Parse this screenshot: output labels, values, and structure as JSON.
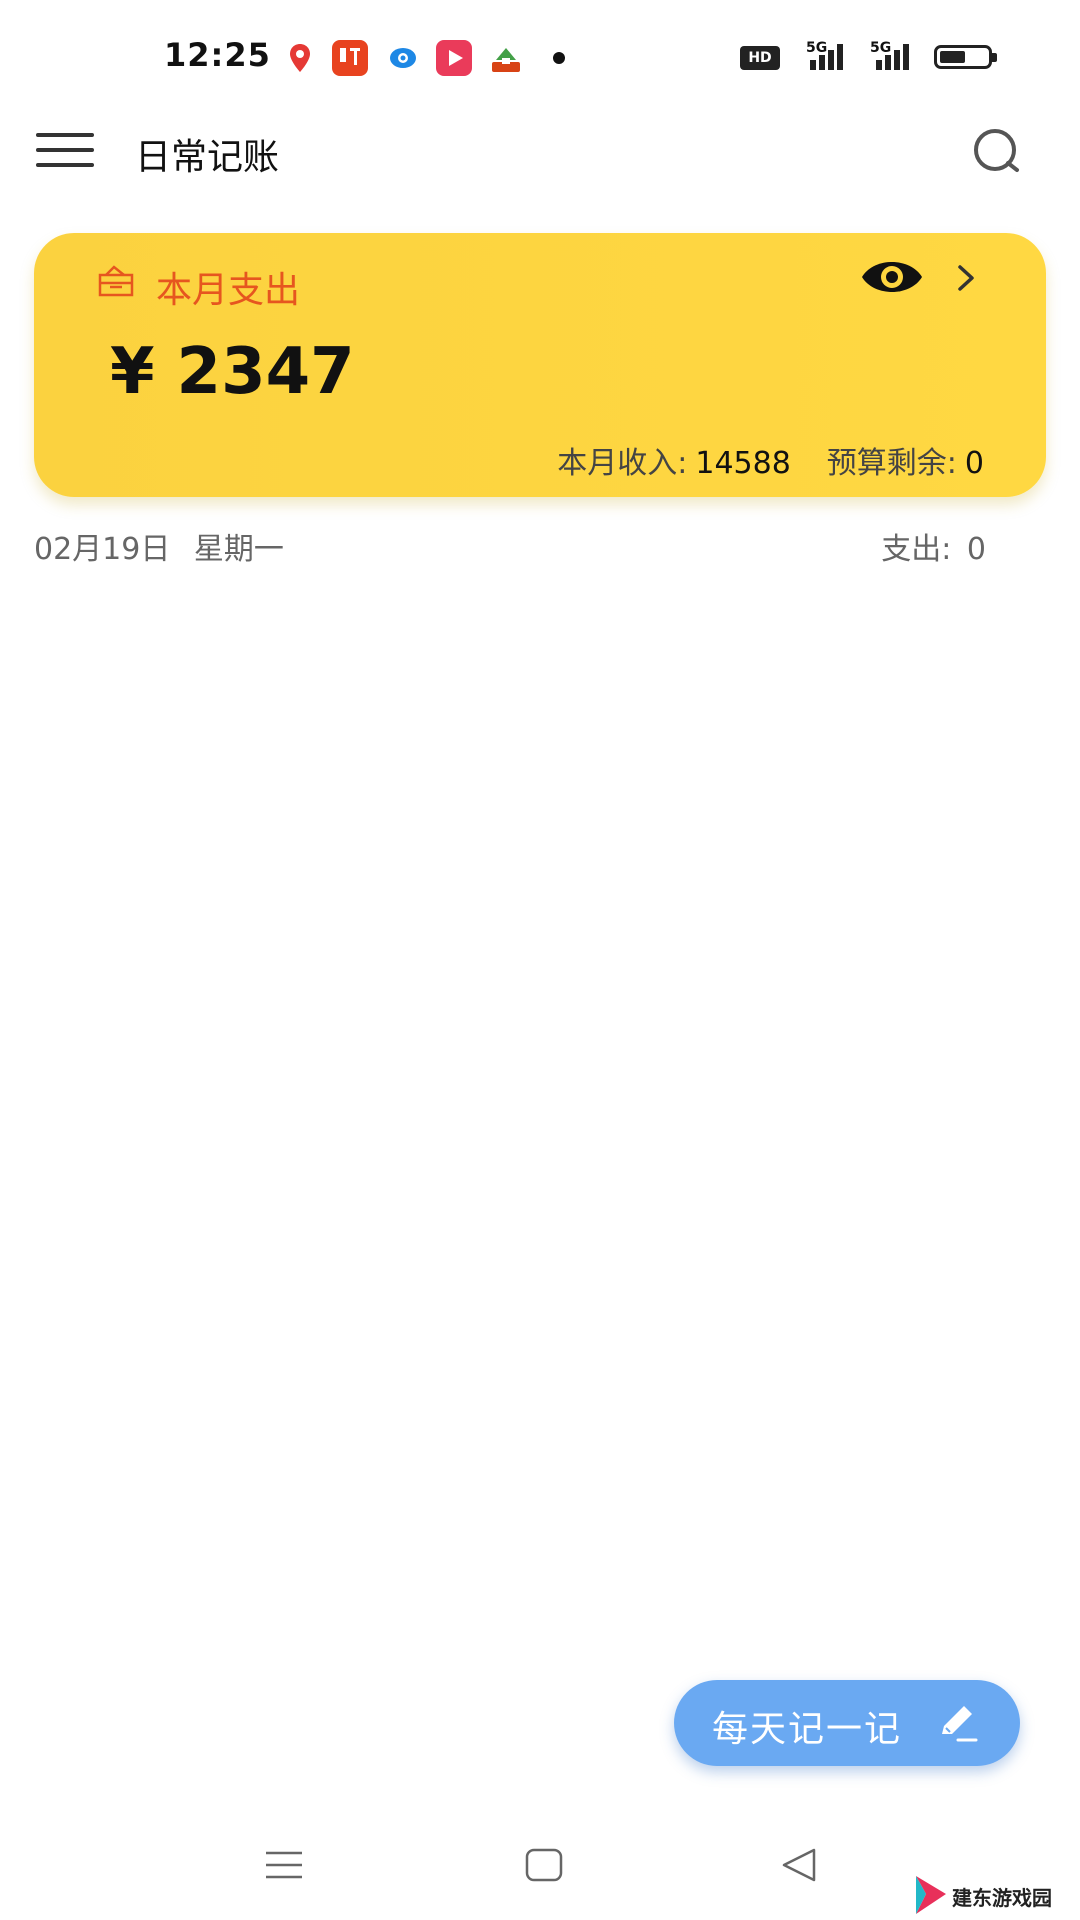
{
  "status_bar": {
    "time": "12:25",
    "network_badge": "HD",
    "signal_1_label": "5G",
    "signal_2_label": "5G",
    "battery_level": 0.55,
    "notification_icons": [
      "map-pin-app-icon",
      "listen-app-icon",
      "chat-app-icon",
      "video-app-icon",
      "home-app-icon"
    ]
  },
  "header": {
    "title": "日常记账"
  },
  "summary_card": {
    "label": "本月支出",
    "currency": "¥",
    "amount": "2347",
    "income_label": "本月收入:",
    "income_value": "14588",
    "budget_label": "预算剩余:",
    "budget_value": "0",
    "colors": {
      "background": "#fdd53f",
      "label": "#e6561f"
    }
  },
  "day_summary": {
    "date": "02月19日",
    "weekday": "星期一",
    "expense_label": "支出:",
    "expense_value": "0"
  },
  "fab": {
    "label": "每天记一记",
    "color": "#6aa9f2"
  },
  "nav_bar": {
    "buttons": [
      "menu-nav-icon",
      "home-nav-icon",
      "back-nav-icon"
    ]
  },
  "watermark": {
    "text": "建东游戏园"
  }
}
